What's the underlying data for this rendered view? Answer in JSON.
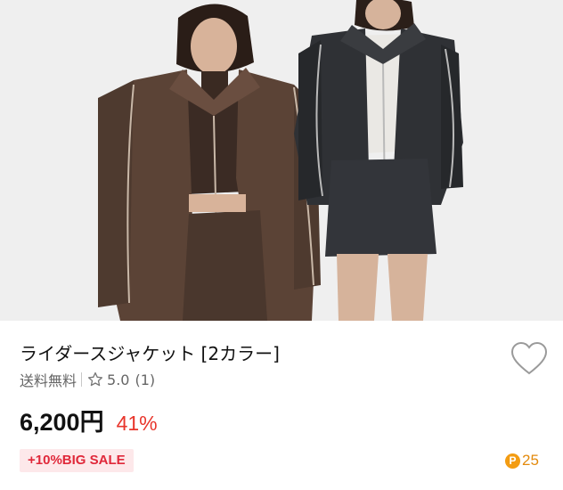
{
  "product": {
    "image_alt": "product-photo",
    "title": "ライダースジャケット [2カラー]",
    "shipping": "送料無料",
    "rating": "5.0",
    "review_count": "(1)",
    "price": "6,200円",
    "discount": "41%",
    "badge": "+10%BIG SALE",
    "points_icon": "P",
    "points": "25"
  },
  "colors": {
    "discount": "#e8352b",
    "badge_bg": "#fde8ea",
    "badge_text": "#e0283a",
    "points": "#f39c12"
  },
  "icons": {
    "favorite": "heart-outline-icon",
    "rating": "star-outline-icon",
    "points": "point-coin-icon"
  }
}
